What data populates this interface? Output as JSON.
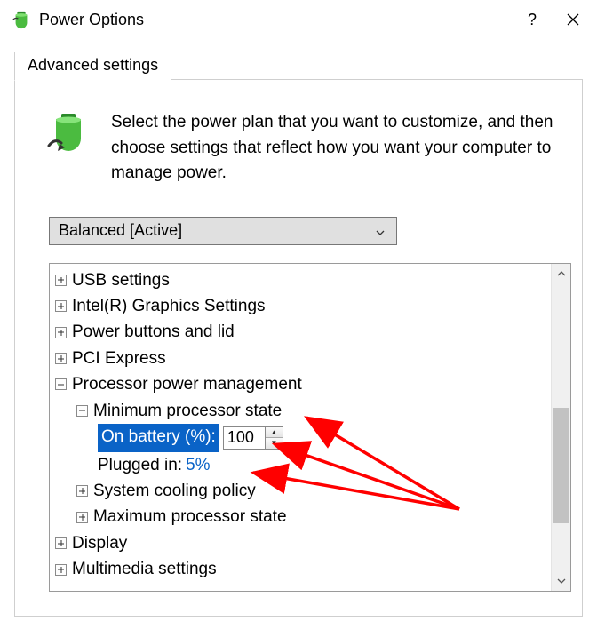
{
  "title": "Power Options",
  "intro_text": "Select the power plan that you want to customize, and then choose settings that reflect how you want your computer to manage power.",
  "tab_label": "Advanced settings",
  "combo_value": "Balanced [Active]",
  "tree": {
    "usb": "USB settings",
    "intel_gfx": "Intel(R) Graphics Settings",
    "power_btn": "Power buttons and lid",
    "pci": "PCI Express",
    "proc_mgmt": "Processor power management",
    "min_proc": "Minimum processor state",
    "on_battery_label": "On battery (%):",
    "on_battery_value": "100",
    "plugged_label": "Plugged in:",
    "plugged_value": "5%",
    "sys_cooling": "System cooling policy",
    "max_proc": "Maximum processor state",
    "display": "Display",
    "multimedia": "Multimedia settings"
  }
}
